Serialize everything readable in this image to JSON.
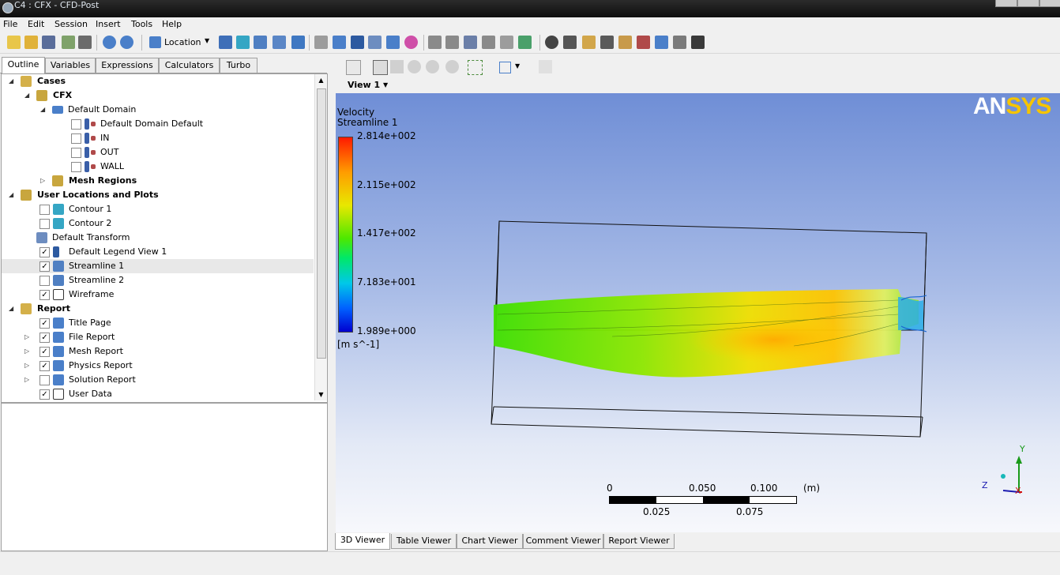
{
  "window": {
    "title": "C4 : CFX - CFD-Post"
  },
  "menu": [
    "File",
    "Edit",
    "Session",
    "Insert",
    "Tools",
    "Help"
  ],
  "toolbar": {
    "location_label": "Location"
  },
  "left_tabs": [
    "Outline",
    "Variables",
    "Expressions",
    "Calculators",
    "Turbo"
  ],
  "tree": [
    {
      "label": "Cases",
      "bold": true,
      "icon": "cases-icon",
      "expanded": true
    },
    {
      "label": "CFX",
      "bold": true,
      "icon": "cfx-case-icon",
      "expanded": true
    },
    {
      "label": "Default Domain",
      "bold": false,
      "icon": "domain-icon",
      "expanded": true
    },
    {
      "label": "Default Domain Default",
      "checked": false,
      "icon": "boundary-icon"
    },
    {
      "label": "IN",
      "checked": false,
      "icon": "boundary-icon"
    },
    {
      "label": "OUT",
      "checked": false,
      "icon": "boundary-icon"
    },
    {
      "label": "WALL",
      "checked": false,
      "icon": "boundary-icon"
    },
    {
      "label": "Mesh Regions",
      "bold": true,
      "icon": "mesh-regions-icon",
      "expanded": false
    },
    {
      "label": "User Locations and Plots",
      "bold": true,
      "icon": "user-locations-icon",
      "expanded": true
    },
    {
      "label": "Contour 1",
      "checked": false,
      "icon": "contour-icon"
    },
    {
      "label": "Contour 2",
      "checked": false,
      "icon": "contour-icon"
    },
    {
      "label": "Default Transform",
      "icon": "transform-icon"
    },
    {
      "label": "Default Legend View 1",
      "checked": true,
      "icon": "legend-icon"
    },
    {
      "label": "Streamline 1",
      "checked": true,
      "icon": "streamline-icon",
      "selected": true
    },
    {
      "label": "Streamline 2",
      "checked": false,
      "icon": "streamline-icon"
    },
    {
      "label": "Wireframe",
      "checked": true,
      "icon": "wireframe-icon"
    },
    {
      "label": "Report",
      "bold": true,
      "icon": "report-icon",
      "expanded": true
    },
    {
      "label": "Title Page",
      "checked": true,
      "icon": "report-page-icon"
    },
    {
      "label": "File Report",
      "checked": true,
      "icon": "report-page-icon",
      "expandable": true
    },
    {
      "label": "Mesh Report",
      "checked": true,
      "icon": "report-page-icon",
      "expandable": true
    },
    {
      "label": "Physics Report",
      "checked": true,
      "icon": "report-page-icon",
      "expandable": true
    },
    {
      "label": "Solution Report",
      "checked": false,
      "icon": "report-page-icon",
      "expandable": true
    },
    {
      "label": "User Data",
      "checked": true,
      "icon": "text-icon"
    }
  ],
  "viewer": {
    "view_label": "View 1",
    "legend": {
      "title": "Velocity",
      "subtitle": "Streamline 1",
      "values": [
        "2.814e+002",
        "2.115e+002",
        "1.417e+002",
        "7.183e+001",
        "1.989e+000"
      ],
      "unit": "[m s^-1]"
    },
    "brand": {
      "left": "AN",
      "right": "SYS"
    },
    "scale": {
      "top_labels": [
        "0",
        "0.050",
        "0.100"
      ],
      "unit": "(m)",
      "bottom_labels": [
        "0.025",
        "0.075"
      ]
    },
    "axes": {
      "y": "Y",
      "z": "Z",
      "x": "X"
    }
  },
  "bottom_tabs": [
    "3D Viewer",
    "Table Viewer",
    "Chart Viewer",
    "Comment Viewer",
    "Report Viewer"
  ],
  "colors": {
    "accent": "#4a7fc9",
    "viewport_top": "#6f8ed6",
    "viewport_bottom": "#f7f8fc"
  }
}
